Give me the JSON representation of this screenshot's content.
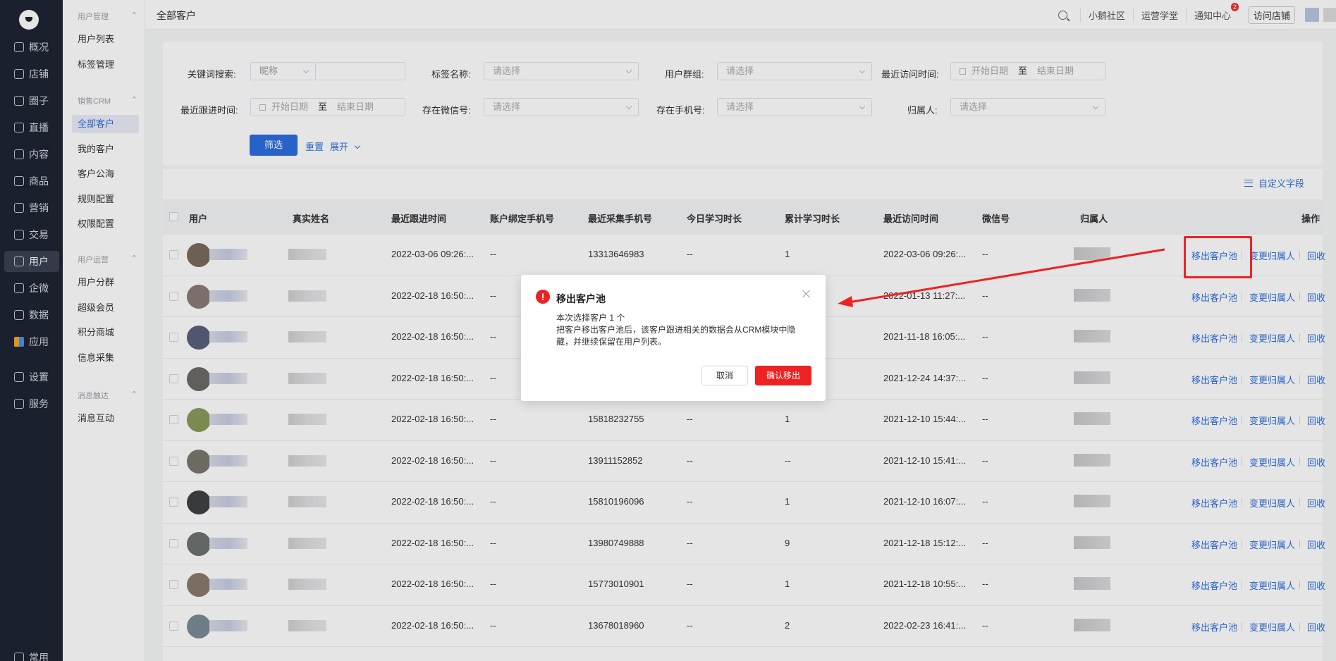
{
  "rail": {
    "items": [
      {
        "label": "概况"
      },
      {
        "label": "店铺"
      },
      {
        "label": "圈子"
      },
      {
        "label": "直播"
      },
      {
        "label": "内容"
      },
      {
        "label": "商品"
      },
      {
        "label": "营销"
      },
      {
        "label": "交易"
      },
      {
        "label": "用户"
      },
      {
        "label": "企微"
      },
      {
        "label": "数据"
      },
      {
        "label": "应用"
      },
      {
        "label": "设置"
      },
      {
        "label": "服务"
      }
    ],
    "bottom_label": "常用"
  },
  "sub": {
    "groups": [
      {
        "title": "用户管理",
        "items": [
          "用户列表",
          "标签管理"
        ]
      },
      {
        "title": "销售CRM",
        "items": [
          "全部客户",
          "我的客户",
          "客户公海",
          "规则配置",
          "权限配置"
        ]
      },
      {
        "title": "用户运营",
        "items": [
          "用户分群",
          "超级会员",
          "积分商城",
          "信息采集"
        ]
      },
      {
        "title": "消息触达",
        "items": [
          "消息互动"
        ]
      }
    ]
  },
  "header": {
    "title": "全部客户",
    "links": [
      "小鹅社区",
      "运营学堂",
      "通知中心"
    ],
    "notify_badge": "2",
    "visit_store": "访问店铺"
  },
  "filter": {
    "keyword_label": "关键词搜索:",
    "keyword_type": "昵称",
    "tag_label": "标签名称:",
    "group_label": "用户群组:",
    "last_visit_label": "最近访问时间:",
    "last_follow_label": "最近跟进时间:",
    "wechat_label": "存在微信号:",
    "phone_label": "存在手机号:",
    "owner_label": "归属人:",
    "select_placeholder": "请选择",
    "start_date": "开始日期",
    "end_date": "结束日期",
    "to": "至",
    "btn_filter": "筛选",
    "btn_reset": "重置",
    "btn_expand": "展开"
  },
  "table": {
    "custom_fields": "自定义字段",
    "columns": [
      "用户",
      "真实姓名",
      "最近跟进时间",
      "账户绑定手机号",
      "最近采集手机号",
      "今日学习时长",
      "累计学习时长",
      "最近访问时间",
      "微信号",
      "归属人",
      "操作"
    ],
    "ops": [
      "移出客户池",
      "变更归属人",
      "回收"
    ],
    "rows": [
      {
        "follow": "2022-03-06 09:26:...",
        "bind_phone": "--",
        "phone": "13313646983",
        "today": "--",
        "total": "1",
        "visit": "2022-03-06 09:26:...",
        "wechat": "--"
      },
      {
        "follow": "2022-02-18 16:50:...",
        "bind_phone": "--",
        "phone": "",
        "today": "",
        "total": "",
        "visit": "2022-01-13 11:27:...",
        "wechat": "--"
      },
      {
        "follow": "2022-02-18 16:50:...",
        "bind_phone": "--",
        "phone": "",
        "today": "",
        "total": "",
        "visit": "2021-11-18 16:05:...",
        "wechat": "--"
      },
      {
        "follow": "2022-02-18 16:50:...",
        "bind_phone": "--",
        "phone": "",
        "today": "",
        "total": "",
        "visit": "2021-12-24 14:37:...",
        "wechat": "--"
      },
      {
        "follow": "2022-02-18 16:50:...",
        "bind_phone": "--",
        "phone": "15818232755",
        "today": "--",
        "total": "1",
        "visit": "2021-12-10 15:44:...",
        "wechat": "--"
      },
      {
        "follow": "2022-02-18 16:50:...",
        "bind_phone": "--",
        "phone": "13911152852",
        "today": "--",
        "total": "--",
        "visit": "2021-12-10 15:41:...",
        "wechat": "--"
      },
      {
        "follow": "2022-02-18 16:50:...",
        "bind_phone": "--",
        "phone": "15810196096",
        "today": "--",
        "total": "1",
        "visit": "2021-12-10 16:07:...",
        "wechat": "--"
      },
      {
        "follow": "2022-02-18 16:50:...",
        "bind_phone": "--",
        "phone": "13980749888",
        "today": "--",
        "total": "9",
        "visit": "2021-12-18 15:12:...",
        "wechat": "--"
      },
      {
        "follow": "2022-02-18 16:50:...",
        "bind_phone": "--",
        "phone": "15773010901",
        "today": "--",
        "total": "1",
        "visit": "2021-12-18 10:55:...",
        "wechat": "--"
      },
      {
        "follow": "2022-02-18 16:50:...",
        "bind_phone": "--",
        "phone": "13678018960",
        "today": "--",
        "total": "2",
        "visit": "2022-02-23 16:41:...",
        "wechat": "--"
      }
    ]
  },
  "dialog": {
    "title": "移出客户池",
    "line1": "本次选择客户 1 个",
    "line2": "把客户移出客户池后，该客户跟进相关的数据会从CRM模块中隐藏，并继续保留在用户列表。",
    "cancel": "取消",
    "confirm": "确认移出"
  },
  "colors": {
    "primary": "#2c6ee0",
    "danger": "#ee2222",
    "rail_bg": "#1e2434"
  }
}
